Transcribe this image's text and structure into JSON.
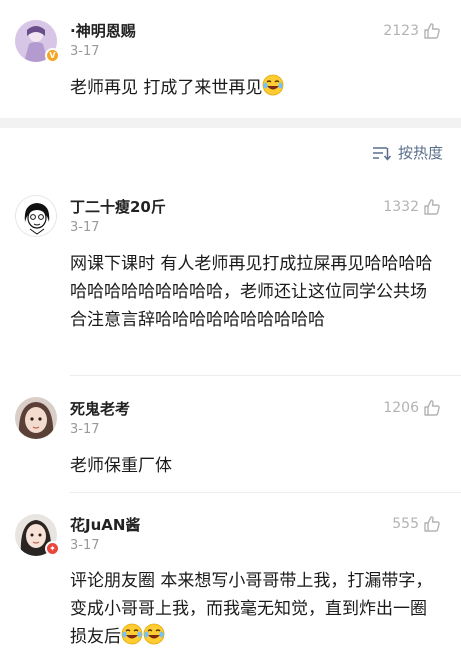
{
  "top_comment": {
    "user": "·神明恩赐",
    "date": "3-17",
    "likes": "2123",
    "text": "老师再见 打成了来世再见"
  },
  "sort": {
    "label": "按热度"
  },
  "comments": [
    {
      "user": "丁二十瘦20斤",
      "date": "3-17",
      "likes": "1332",
      "text": "网课下课时 有人老师再见打成拉屎再见哈哈哈哈哈哈哈哈哈哈哈哈哈，老师还让这位同学公共场合注意言辞哈哈哈哈哈哈哈哈哈哈"
    },
    {
      "user": "死鬼老考",
      "date": "3-17",
      "likes": "1206",
      "text": "老师保重厂体"
    },
    {
      "user": "花JuAN酱",
      "date": "3-17",
      "likes": "555",
      "text": "评论朋友圈 本来想写小哥哥带上我，打漏带字，变成小哥哥上我，而我毫无知觉，直到炸出一圈损友后"
    }
  ],
  "colors": {
    "sort_blue": "#5b6f8c",
    "muted": "#999999",
    "badge_vip": "#f5a623",
    "badge_red": "#e8473e"
  }
}
